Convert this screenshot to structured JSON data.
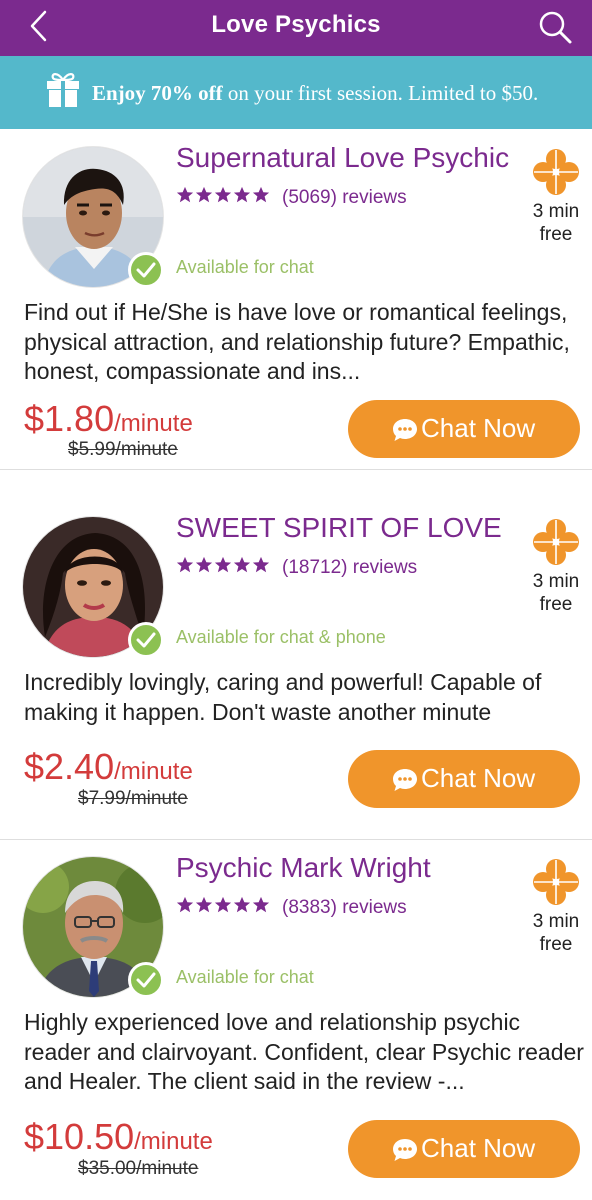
{
  "header": {
    "title": "Love Psychics",
    "back_icon": "chevron-left-icon",
    "search_icon": "search-icon"
  },
  "promo": {
    "icon": "gift-icon",
    "bold_part": "Enjoy 70% off",
    "rest_part": " on your first session. Limited to $50."
  },
  "colors": {
    "header_bg": "#7b2a8e",
    "promo_bg": "#54b8cb",
    "accent_purple": "#7b2a8e",
    "price_red": "#d33b3b",
    "button_orange": "#f0952b",
    "available_green": "#9bc067"
  },
  "psychics": [
    {
      "name": "Supernatural Love Psychic",
      "rating_stars": 5,
      "reviews": "(5069) reviews",
      "free_line1": "3 min",
      "free_line2": "free",
      "availability": "Available for chat",
      "description": "Find out if He/She is have love or romantical feelings, physical attraction, and relationship future? Empathic, honest, compassionate and ins...",
      "price": "$1.80",
      "price_unit": "/minute",
      "old_price": "$5.99/minute",
      "button_label": "Chat Now"
    },
    {
      "name": "SWEET SPIRIT OF LOVE",
      "rating_stars": 5,
      "reviews": "(18712) reviews",
      "free_line1": "3 min",
      "free_line2": "free",
      "availability": "Available for chat & phone",
      "description": "Incredibly lovingly, caring and powerful! Capable of making it happen. Don't waste another minute",
      "price": "$2.40",
      "price_unit": "/minute",
      "old_price": "$7.99/minute",
      "button_label": "Chat Now"
    },
    {
      "name": "Psychic Mark Wright",
      "rating_stars": 5,
      "reviews": "(8383) reviews",
      "free_line1": "3 min",
      "free_line2": "free",
      "availability": "Available for chat",
      "description": "Highly experienced love and relationship psychic reader and clairvoyant. Confident, clear Psychic reader and Healer. The client said in the review -...",
      "price": "$10.50",
      "price_unit": "/minute",
      "old_price": "$35.00/minute",
      "button_label": "Chat Now"
    }
  ]
}
